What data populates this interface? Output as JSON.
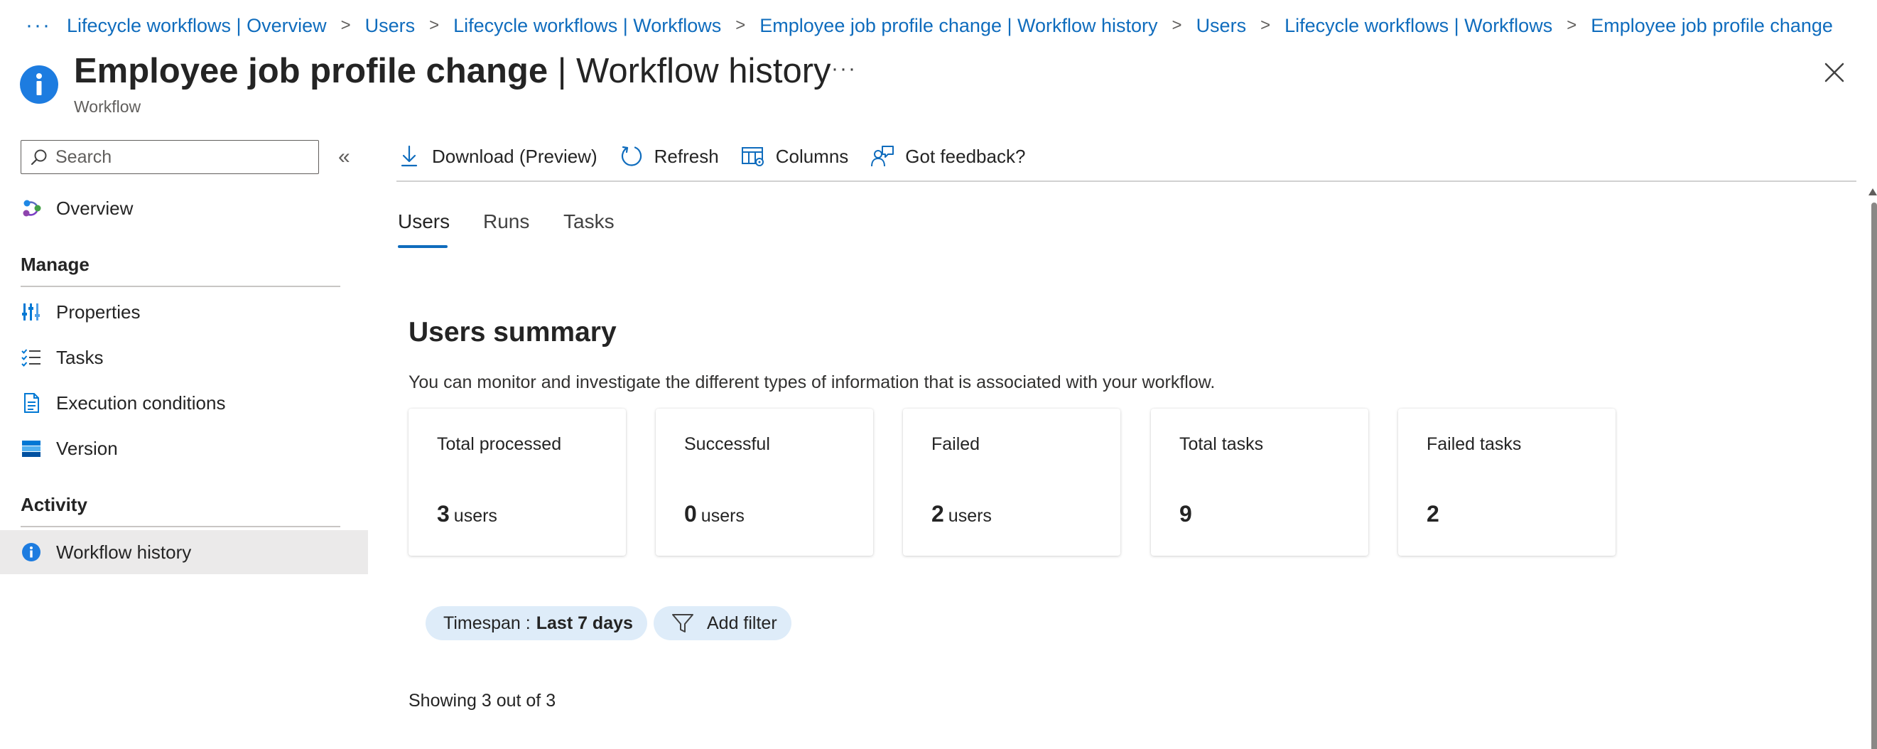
{
  "breadcrumb": {
    "more": "···",
    "items": [
      "Lifecycle workflows | Overview",
      "Users",
      "Lifecycle workflows | Workflows",
      "Employee job profile change | Workflow history",
      "Users",
      "Lifecycle workflows | Workflows",
      "Employee job profile change"
    ]
  },
  "header": {
    "title_main": "Employee job profile change",
    "title_sep": " | ",
    "title_page": "Workflow history",
    "subtitle": "Workflow",
    "more": "···",
    "icon": "info-icon"
  },
  "sidebar": {
    "search_placeholder": "Search",
    "collapse": "«",
    "overview": "Overview",
    "manage_label": "Manage",
    "manage_items": [
      "Properties",
      "Tasks",
      "Execution conditions",
      "Version"
    ],
    "activity_label": "Activity",
    "activity_items": [
      "Workflow history"
    ]
  },
  "toolbar": {
    "download": "Download (Preview)",
    "refresh": "Refresh",
    "columns": "Columns",
    "feedback": "Got feedback?"
  },
  "tabs": [
    "Users",
    "Runs",
    "Tasks"
  ],
  "summary": {
    "title": "Users summary",
    "description": "You can monitor and investigate the different types of information that is associated with your workflow.",
    "cards": [
      {
        "label": "Total processed",
        "value": "3",
        "unit": "users"
      },
      {
        "label": "Successful",
        "value": "0",
        "unit": "users"
      },
      {
        "label": "Failed",
        "value": "2",
        "unit": "users"
      },
      {
        "label": "Total tasks",
        "value": "9",
        "unit": ""
      },
      {
        "label": "Failed tasks",
        "value": "2",
        "unit": ""
      }
    ]
  },
  "filters": {
    "timespan_label": "Timespan :",
    "timespan_value": "Last 7 days",
    "add_filter": "Add filter"
  },
  "showing": "Showing 3 out of 3",
  "colors": {
    "accent": "#0f6cbd",
    "pill_bg": "#deecf9",
    "active_nav_bg": "#ebeaea"
  }
}
